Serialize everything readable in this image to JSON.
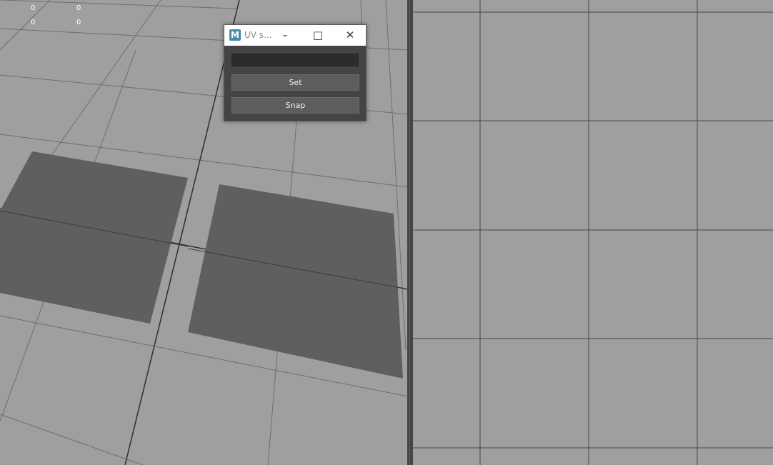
{
  "hud": {
    "row1_col1": "0",
    "row1_col2": "0",
    "row2_col1": "0",
    "row2_col2": "0"
  },
  "window": {
    "app_icon_letter": "M",
    "title": "UV s...",
    "minimize_glyph": "–",
    "maximize_glyph": "□",
    "close_glyph": "✕"
  },
  "form": {
    "input_value": "",
    "set_label": "Set",
    "snap_label": "Snap"
  },
  "colors": {
    "viewport_bg": "#9f9f9f",
    "plane_fill": "#5f5f5f",
    "grid_line": "#3a3a3a",
    "dialog_bg": "#444444",
    "button_bg": "#5d5d5d",
    "app_icon_accent": "#4a8aa3"
  }
}
